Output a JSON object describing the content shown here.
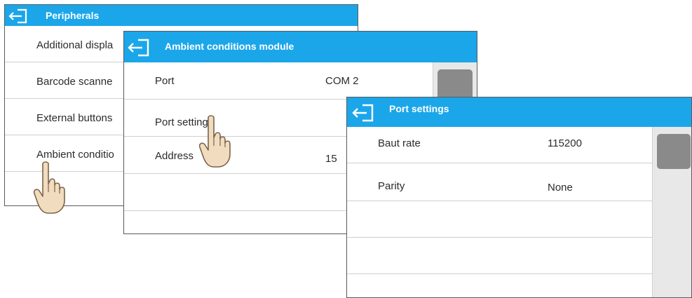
{
  "windows": {
    "peripherals": {
      "title": "Peripherals",
      "items": [
        {
          "label": "Additional displa"
        },
        {
          "label": "Barcode scanne"
        },
        {
          "label": "External buttons"
        },
        {
          "label": "Ambient conditio"
        }
      ]
    },
    "ambient": {
      "title": "Ambient conditions module",
      "rows": [
        {
          "label": "Port",
          "value": "COM 2"
        },
        {
          "label": "Port settings",
          "value": ""
        },
        {
          "label": "Address",
          "value": "15"
        }
      ]
    },
    "port_settings": {
      "title": "Port settings",
      "rows": [
        {
          "label": "Baut rate",
          "value": "115200"
        },
        {
          "label": "Parity",
          "value": "None"
        }
      ]
    }
  },
  "colors": {
    "titlebar": "#1ba6ea",
    "scroll_thumb": "#8a8a8a"
  },
  "icons": {
    "back": "exit-arrow-icon",
    "pointer": "hand-pointer-icon"
  }
}
